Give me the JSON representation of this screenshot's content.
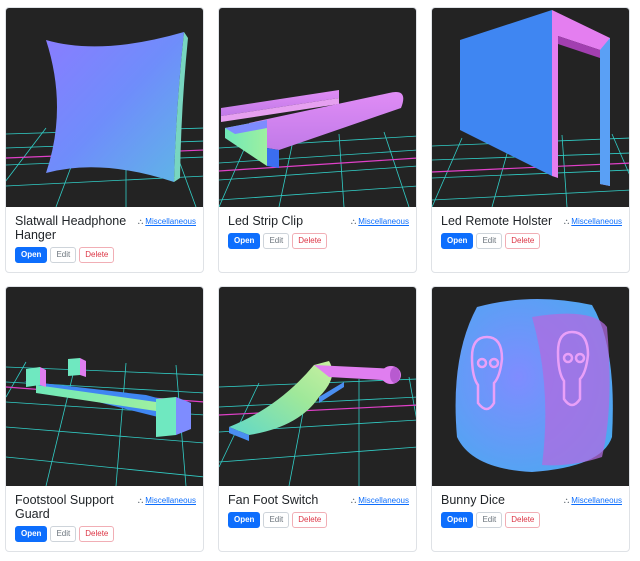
{
  "cards": [
    {
      "title": "Slatwall Headphone Hanger",
      "category": "Miscellaneous",
      "category_icon": "three-circles-icon",
      "open_label": "Open",
      "edit_label": "Edit",
      "delete_label": "Delete"
    },
    {
      "title": "Led Strip Clip",
      "category": "Miscellaneous",
      "category_icon": "three-circles-icon",
      "open_label": "Open",
      "edit_label": "Edit",
      "delete_label": "Delete"
    },
    {
      "title": "Led Remote Holster",
      "category": "Miscellaneous",
      "category_icon": "three-circles-icon",
      "open_label": "Open",
      "edit_label": "Edit",
      "delete_label": "Delete"
    },
    {
      "title": "Footstool Support Guard",
      "category": "Miscellaneous",
      "category_icon": "three-circles-icon",
      "open_label": "Open",
      "edit_label": "Edit",
      "delete_label": "Delete"
    },
    {
      "title": "Fan Foot Switch",
      "category": "Miscellaneous",
      "category_icon": "three-circles-icon",
      "open_label": "Open",
      "edit_label": "Edit",
      "delete_label": "Delete"
    },
    {
      "title": "Bunny Dice",
      "category": "Miscellaneous",
      "category_icon": "three-circles-icon",
      "open_label": "Open",
      "edit_label": "Edit",
      "delete_label": "Delete"
    }
  ],
  "colors": {
    "open_button": "#0d6efd",
    "delete_text": "#dc3545",
    "link": "#0d6efd",
    "preview_background": "#232323",
    "grid_cyan": "#33e0d8",
    "grid_magenta": "#e040c8"
  }
}
